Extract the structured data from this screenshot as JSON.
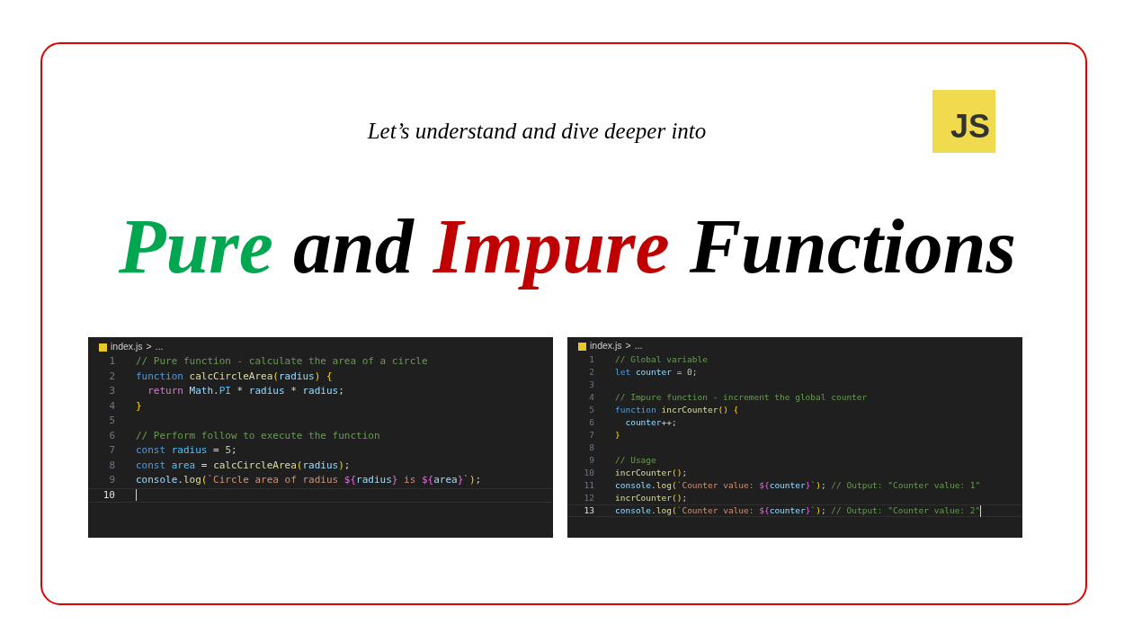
{
  "subtitle": "Let’s understand and dive deeper into",
  "logo": {
    "text": "JS"
  },
  "title": [
    {
      "text": "Pure",
      "color": "#00a650"
    },
    {
      "text": "and",
      "color": "#000000"
    },
    {
      "text": "Impure",
      "color": "#c00000"
    },
    {
      "text": "Functions",
      "color": "#000000"
    }
  ],
  "editors": [
    {
      "breadcrumb": {
        "file": "index.js",
        "separator": ">",
        "rest": "..."
      },
      "lines": [
        {
          "number": "1",
          "selected": false,
          "tokens": [
            {
              "kind": "comment",
              "text": "// Pure function - calculate the area of a circle"
            }
          ]
        },
        {
          "number": "2",
          "selected": false,
          "tokens": [
            {
              "kind": "keyword",
              "text": "function "
            },
            {
              "kind": "func",
              "text": "calcCircleArea"
            },
            {
              "kind": "bracket",
              "text": "("
            },
            {
              "kind": "var",
              "text": "radius"
            },
            {
              "kind": "bracket",
              "text": ") {"
            }
          ]
        },
        {
          "number": "3",
          "selected": false,
          "tokens": [
            {
              "kind": "control",
              "text": "  return "
            },
            {
              "kind": "var",
              "text": "Math"
            },
            {
              "kind": "plain",
              "text": "."
            },
            {
              "kind": "const",
              "text": "PI"
            },
            {
              "kind": "plain",
              "text": " * "
            },
            {
              "kind": "var",
              "text": "radius"
            },
            {
              "kind": "plain",
              "text": " * "
            },
            {
              "kind": "var",
              "text": "radius"
            },
            {
              "kind": "plain",
              "text": ";"
            }
          ]
        },
        {
          "number": "4",
          "selected": false,
          "tokens": [
            {
              "kind": "bracket",
              "text": "}"
            }
          ]
        },
        {
          "number": "5",
          "selected": false
        },
        {
          "number": "6",
          "selected": false,
          "tokens": [
            {
              "kind": "comment",
              "text": "// Perform follow to execute the function"
            }
          ]
        },
        {
          "number": "7",
          "selected": false,
          "tokens": [
            {
              "kind": "keyword",
              "text": "const "
            },
            {
              "kind": "const",
              "text": "radius"
            },
            {
              "kind": "plain",
              "text": " = "
            },
            {
              "kind": "number",
              "text": "5"
            },
            {
              "kind": "plain",
              "text": ";"
            }
          ]
        },
        {
          "number": "8",
          "selected": false,
          "tokens": [
            {
              "kind": "keyword",
              "text": "const "
            },
            {
              "kind": "const",
              "text": "area"
            },
            {
              "kind": "plain",
              "text": " = "
            },
            {
              "kind": "func",
              "text": "calcCircleArea"
            },
            {
              "kind": "bracket",
              "text": "("
            },
            {
              "kind": "var",
              "text": "radius"
            },
            {
              "kind": "bracket",
              "text": ")"
            },
            {
              "kind": "plain",
              "text": ";"
            }
          ]
        },
        {
          "number": "9",
          "selected": false,
          "tokens": [
            {
              "kind": "var",
              "text": "console"
            },
            {
              "kind": "plain",
              "text": "."
            },
            {
              "kind": "func",
              "text": "log"
            },
            {
              "kind": "bracket",
              "text": "("
            },
            {
              "kind": "string",
              "text": "`Circle area of radius "
            },
            {
              "kind": "bracket2",
              "text": "${"
            },
            {
              "kind": "var",
              "text": "radius"
            },
            {
              "kind": "bracket2",
              "text": "}"
            },
            {
              "kind": "string",
              "text": " is "
            },
            {
              "kind": "bracket2",
              "text": "${"
            },
            {
              "kind": "var",
              "text": "area"
            },
            {
              "kind": "bracket2",
              "text": "}"
            },
            {
              "kind": "string",
              "text": "`"
            },
            {
              "kind": "bracket",
              "text": ")"
            },
            {
              "kind": "plain",
              "text": ";"
            }
          ]
        },
        {
          "number": "10",
          "selected": true
        }
      ]
    },
    {
      "breadcrumb": {
        "file": "index.js",
        "separator": ">",
        "rest": "..."
      },
      "lines": [
        {
          "number": "1",
          "selected": false,
          "tokens": [
            {
              "kind": "comment",
              "text": "// Global variable"
            }
          ]
        },
        {
          "number": "2",
          "selected": false,
          "tokens": [
            {
              "kind": "keyword",
              "text": "let "
            },
            {
              "kind": "var",
              "text": "counter"
            },
            {
              "kind": "plain",
              "text": " = "
            },
            {
              "kind": "number",
              "text": "0"
            },
            {
              "kind": "plain",
              "text": ";"
            }
          ]
        },
        {
          "number": "3",
          "selected": false
        },
        {
          "number": "4",
          "selected": false,
          "tokens": [
            {
              "kind": "comment",
              "text": "// Impure function - increment the global counter"
            }
          ]
        },
        {
          "number": "5",
          "selected": false,
          "tokens": [
            {
              "kind": "keyword",
              "text": "function "
            },
            {
              "kind": "func",
              "text": "incrCounter"
            },
            {
              "kind": "bracket",
              "text": "() {"
            }
          ]
        },
        {
          "number": "6",
          "selected": false,
          "tokens": [
            {
              "kind": "var",
              "text": "  counter"
            },
            {
              "kind": "plain",
              "text": "++;"
            }
          ]
        },
        {
          "number": "7",
          "selected": false,
          "tokens": [
            {
              "kind": "bracket",
              "text": "}"
            }
          ]
        },
        {
          "number": "8",
          "selected": false
        },
        {
          "number": "9",
          "selected": false,
          "tokens": [
            {
              "kind": "comment",
              "text": "// Usage"
            }
          ]
        },
        {
          "number": "10",
          "selected": false,
          "tokens": [
            {
              "kind": "func",
              "text": "incrCounter"
            },
            {
              "kind": "bracket",
              "text": "()"
            },
            {
              "kind": "plain",
              "text": ";"
            }
          ]
        },
        {
          "number": "11",
          "selected": false,
          "tokens": [
            {
              "kind": "var",
              "text": "console"
            },
            {
              "kind": "plain",
              "text": "."
            },
            {
              "kind": "func",
              "text": "log"
            },
            {
              "kind": "bracket",
              "text": "("
            },
            {
              "kind": "string",
              "text": "`Counter value: "
            },
            {
              "kind": "bracket2",
              "text": "${"
            },
            {
              "kind": "var",
              "text": "counter"
            },
            {
              "kind": "bracket2",
              "text": "}"
            },
            {
              "kind": "string",
              "text": "`"
            },
            {
              "kind": "bracket",
              "text": ")"
            },
            {
              "kind": "plain",
              "text": "; "
            },
            {
              "kind": "comment",
              "text": "// Output: \"Counter value: 1\""
            }
          ]
        },
        {
          "number": "12",
          "selected": false,
          "tokens": [
            {
              "kind": "func",
              "text": "incrCounter"
            },
            {
              "kind": "bracket",
              "text": "()"
            },
            {
              "kind": "plain",
              "text": ";"
            }
          ]
        },
        {
          "number": "13",
          "selected": true,
          "tokens": [
            {
              "kind": "var",
              "text": "console"
            },
            {
              "kind": "plain",
              "text": "."
            },
            {
              "kind": "func",
              "text": "log"
            },
            {
              "kind": "bracket",
              "text": "("
            },
            {
              "kind": "string",
              "text": "`Counter value: "
            },
            {
              "kind": "bracket2",
              "text": "${"
            },
            {
              "kind": "var",
              "text": "counter"
            },
            {
              "kind": "bracket2",
              "text": "}"
            },
            {
              "kind": "string",
              "text": "`"
            },
            {
              "kind": "bracket",
              "text": ")"
            },
            {
              "kind": "plain",
              "text": "; "
            },
            {
              "kind": "comment",
              "text": "// Output: \"Counter value: 2\""
            }
          ]
        }
      ]
    }
  ]
}
